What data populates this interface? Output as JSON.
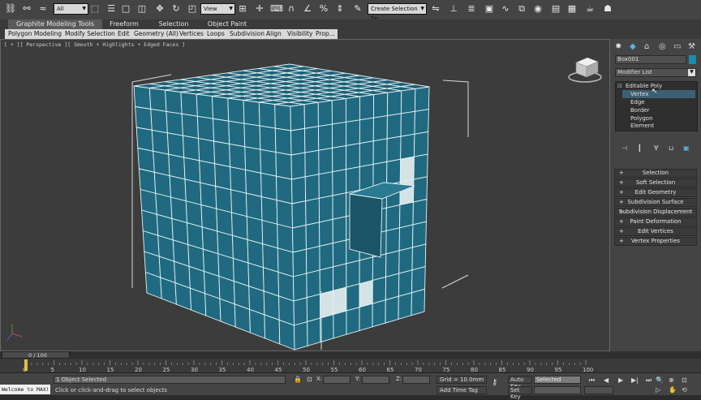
{
  "toolbar": {
    "filter_select": "All",
    "refcoord_select": "View",
    "named_selection": "Create Selection Se"
  },
  "ribbon": {
    "tabs": [
      "Graphite Modeling Tools",
      "Freeform",
      "Selection",
      "Object Paint"
    ],
    "items": [
      "Polygon Modeling",
      "Modify Selection",
      "Edit",
      "Geometry (All)",
      "Vertices",
      "Loops",
      "Subdivision",
      "Align",
      "Visibility",
      "Prop..."
    ]
  },
  "viewport": {
    "label": "[ + ][ Perspective ][ Smooth + Highlights + Edged Faces ]"
  },
  "panel": {
    "object_name": "Box001",
    "modifier_list": "Modifier List",
    "stack": [
      "Editable Poly",
      "Vertex",
      "Edge",
      "Border",
      "Polygon",
      "Element"
    ],
    "rollouts": [
      "Selection",
      "Soft Selection",
      "Edit Geometry",
      "Subdivision Surface",
      "Subdivision Displacement",
      "Paint Deformation",
      "Edit Vertices",
      "Vertex Properties"
    ]
  },
  "timeline": {
    "frame_label": "0 / 100",
    "ticks": [
      "0",
      "5",
      "10",
      "15",
      "20",
      "25",
      "30",
      "35",
      "40",
      "45",
      "50",
      "55",
      "60",
      "65",
      "70",
      "75",
      "80",
      "85",
      "90",
      "95",
      "100"
    ]
  },
  "status": {
    "welcome": "Welcome to MAX!",
    "selected": "1 Object Selected",
    "prompt": "Click or click-and-drag to select objects",
    "x_label": "X:",
    "y_label": "Y:",
    "z_label": "Z:",
    "grid": "Grid = 10.0mm",
    "add_time_tag": "Add Time Tag",
    "auto_key": "Auto Key",
    "set_key": "Set Key",
    "key_mode_select": "Selected"
  },
  "colors": {
    "mesh": "#1f6a80",
    "wire": "#e8f2f4",
    "viewport_bg": "#3c3c3c"
  }
}
